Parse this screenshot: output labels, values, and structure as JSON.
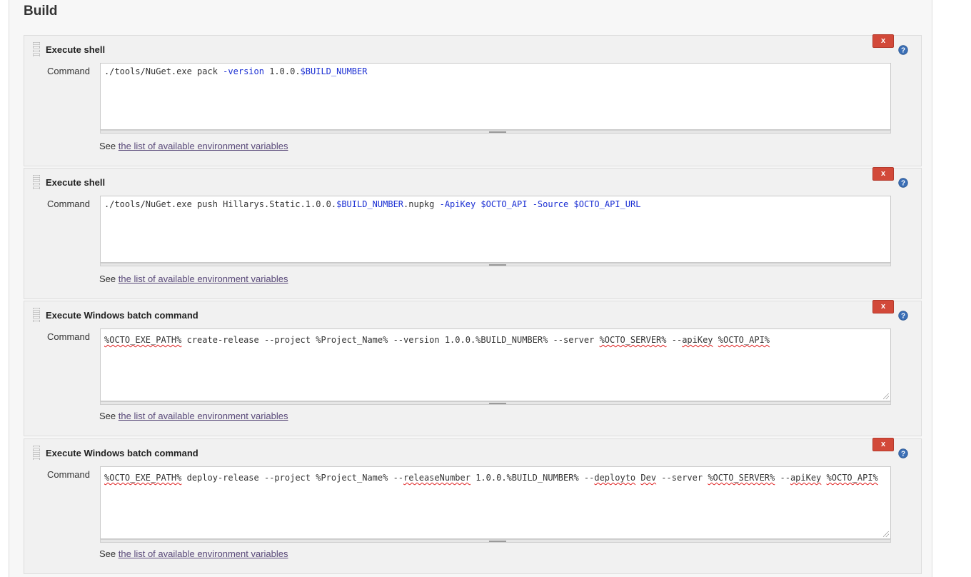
{
  "section": {
    "title": "Build"
  },
  "steps": [
    {
      "title": "Execute shell",
      "delete_label": "x",
      "command_label": "Command",
      "command": "./tools/NuGet.exe pack -version 1.0.0.$BUILD_NUMBER",
      "see_prefix": "See",
      "see_link": "the list of available environment variables"
    },
    {
      "title": "Execute shell",
      "delete_label": "x",
      "command_label": "Command",
      "command": "./tools/NuGet.exe push Hillarys.Static.1.0.0.$BUILD_NUMBER.nupkg -ApiKey $OCTO_API -Source $OCTO_API_URL",
      "see_prefix": "See",
      "see_link": "the list of available environment variables"
    },
    {
      "title": "Execute Windows batch command",
      "delete_label": "x",
      "command_label": "Command",
      "command": "%OCTO_EXE_PATH% create-release --project %Project_Name% --version 1.0.0.%BUILD_NUMBER% --server %OCTO_SERVER% --apiKey %OCTO_API%",
      "see_prefix": "See",
      "see_link": "the list of available environment variables"
    },
    {
      "title": "Execute Windows batch command",
      "delete_label": "x",
      "command_label": "Command",
      "command": "%OCTO_EXE_PATH% deploy-release --project %Project_Name% --releaseNumber 1.0.0.%BUILD_NUMBER% --deployto Dev --server %OCTO_SERVER% --apiKey %OCTO_API%",
      "see_prefix": "See",
      "see_link": "the list of available environment variables"
    }
  ],
  "colors": {
    "delete_button": "#d24939",
    "help_icon": "#3b6fb6",
    "link": "#5a4a7a",
    "shell_keyword": "#1b2fd3"
  },
  "icons": {
    "help": "help-icon",
    "delete": "delete-icon",
    "drag": "drag-handle-icon"
  }
}
